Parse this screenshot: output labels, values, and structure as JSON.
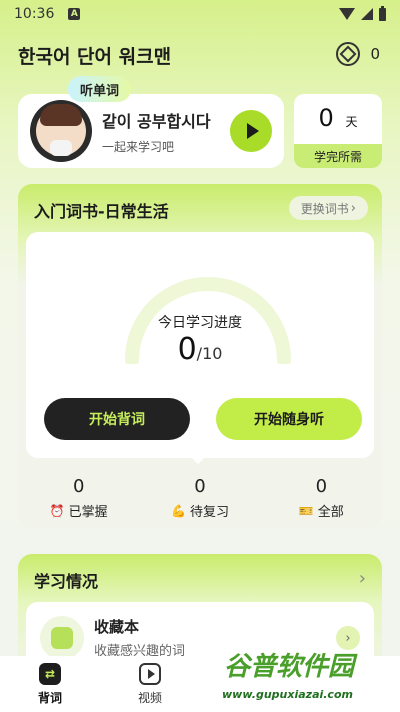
{
  "status_bar": {
    "time": "10:36",
    "indicator": "A"
  },
  "header": {
    "app_title": "한국어 단어 워크맨",
    "coins": "0"
  },
  "speak_card": {
    "badge": "听单词",
    "title": "같이 공부합시다",
    "subtitle": "一起来学习吧"
  },
  "days_card": {
    "value": "0",
    "unit": "天",
    "label": "学完所需"
  },
  "book": {
    "title": "入门词书-日常生活",
    "change_label": "更换词书",
    "progress_label": "今日学习进度",
    "progress_done": "0",
    "progress_total": "/10",
    "progress_fraction": 0,
    "start_button": "开始背词",
    "listen_button": "开始随身听",
    "stats": [
      {
        "value": "0",
        "label": "已掌握",
        "icon": "alarm-clock-icon",
        "glyph": "⏰"
      },
      {
        "value": "0",
        "label": "待复习",
        "icon": "muscle-icon",
        "glyph": "💪"
      },
      {
        "value": "0",
        "label": "全部",
        "icon": "ticket-icon",
        "glyph": "🎫"
      }
    ]
  },
  "learning": {
    "title": "学习情况",
    "favorites_title": "收藏本",
    "favorites_subtitle": "收藏感兴趣的词"
  },
  "nav": {
    "items": [
      {
        "label": "背词"
      },
      {
        "label": "视频"
      }
    ]
  },
  "watermark": {
    "title": "谷普软件园",
    "url": "www.gupuxiazai.com"
  },
  "colors": {
    "accent": "#c2ec48",
    "dark": "#222222",
    "header_gradient": "#d6f08a"
  }
}
